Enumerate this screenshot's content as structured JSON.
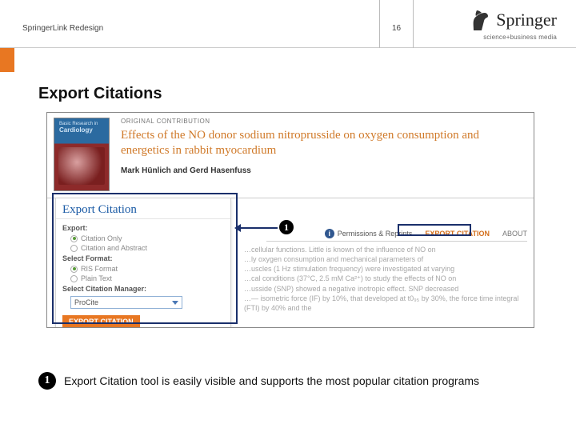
{
  "header": {
    "left_label": "SpringerLink Redesign",
    "page_number": "16",
    "brand_name": "Springer",
    "brand_tagline": "science+business media"
  },
  "page_title": "Export Citations",
  "article": {
    "journal_thumb_line1": "Basic Research in",
    "journal_thumb_line2": "Cardiology",
    "kicker": "ORIGINAL CONTRIBUTION",
    "title": "Effects of the NO donor sodium nitroprusside on oxygen consumption and energetics in rabbit myocardium",
    "authors": "Mark Hünlich and Gerd Hasenfuss"
  },
  "export_panel": {
    "title": "Export Citation",
    "group_export": "Export:",
    "opt_citation_only": "Citation Only",
    "opt_citation_abstract": "Citation and Abstract",
    "group_format": "Select Format:",
    "opt_ris": "RIS Format",
    "opt_plain": "Plain Text",
    "group_manager": "Select Citation Manager:",
    "manager_value": "ProCite",
    "button": "EXPORT CITATION"
  },
  "tabs": {
    "filler": "",
    "permissions": "Permissions & Reprints",
    "export": "EXPORT CITATION",
    "about": "ABOUT"
  },
  "abstract_blur": "…cellular functions. Little is known of the influence of NO on\n…ly oxygen consumption and mechanical parameters of\n…uscles (1 Hz stimulation frequency) were investigated at varying\n…cal conditions (37°C, 2.5 mM Ca²⁺) to study the effects of NO on\n…usside (SNP) showed a negative inotropic effect. SNP decreased\n…— isometric force (IF) by 10%, that developed at t0₉₅ by 30%, the force time integral (FTI) by 40% and the",
  "callouts": {
    "one": "1"
  },
  "caption": "Export Citation tool is easily visible and supports the most popular citation programs"
}
